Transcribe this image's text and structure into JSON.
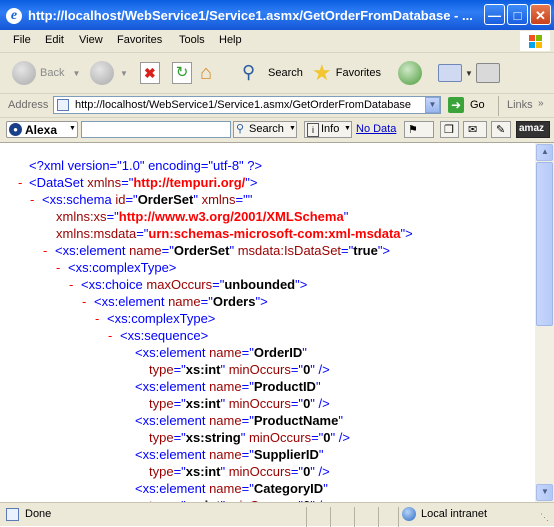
{
  "window": {
    "title": "http://localhost/WebService1/Service1.asmx/GetOrderFromDatabase - ..."
  },
  "menu": [
    "File",
    "Edit",
    "View",
    "Favorites",
    "Tools",
    "Help"
  ],
  "toolbar": {
    "back_label": "Back",
    "search_label": "Search",
    "favorites_label": "Favorites"
  },
  "address": {
    "label": "Address",
    "url": "http://localhost/WebService1/Service1.asmx/GetOrderFromDatabase",
    "go_label": "Go",
    "links_label": "Links"
  },
  "alexa": {
    "brand": "Alexa",
    "search_value": "",
    "search_label": "Search",
    "info_label": "Info",
    "nodata_label": "No Data",
    "amazon_label": "amaz"
  },
  "xml_lines": {
    "l0": {
      "pi": "<?xml version=\"1.0\" encoding=\"utf-8\" ?>"
    },
    "l1": {
      "open": "<DataSet ",
      "attr": "xmlns",
      "q1": "=\"",
      "val": "http://tempuri.org/",
      "q2": "\">"
    },
    "l2": {
      "open": "<xs:schema ",
      "a1": "id",
      "q1": "=\"",
      "v1": "OrderSet",
      "q2": "\" ",
      "a2": "xmlns",
      "q3": "=\"\""
    },
    "l3": {
      "a": "xmlns:xs",
      "q1": "=\"",
      "v": "http://www.w3.org/2001/XMLSchema",
      "q2": "\""
    },
    "l4": {
      "a": "xmlns:msdata",
      "q1": "=\"",
      "v": "urn:schemas-microsoft-com:xml-msdata",
      "q2": "\">"
    },
    "l5": {
      "open": "<xs:element ",
      "a1": "name",
      "q1": "=\"",
      "v1": "OrderSet",
      "q2": "\" ",
      "a2": "msdata:IsDataSet",
      "q3": "=\"",
      "v2": "true",
      "q4": "\">"
    },
    "l6": {
      "t": "<xs:complexType>"
    },
    "l7": {
      "open": "<xs:choice ",
      "a1": "maxOccurs",
      "q1": "=\"",
      "v1": "unbounded",
      "q2": "\">"
    },
    "l8": {
      "open": "<xs:element ",
      "a1": "name",
      "q1": "=\"",
      "v1": "Orders",
      "q2": "\">"
    },
    "l9": {
      "t": "<xs:complexType>"
    },
    "l10": {
      "t": "<xs:sequence>"
    },
    "fields": [
      {
        "name": "OrderID",
        "type": "xs:int"
      },
      {
        "name": "ProductID",
        "type": "xs:int"
      },
      {
        "name": "ProductName",
        "type": "xs:string"
      },
      {
        "name": "SupplierID",
        "type": "xs:int"
      },
      {
        "name": "CategoryID",
        "type": "xs:int"
      }
    ],
    "el_open": "<xs:element ",
    "name_attr": "name",
    "q_open": "=\"",
    "q_close": "\"",
    "type_attr": "type",
    "min_attr": "minOccurs",
    "min_val": "0",
    "close": " />",
    "minus": "-"
  },
  "status": {
    "text": "Done",
    "zone": "Local intranet"
  }
}
